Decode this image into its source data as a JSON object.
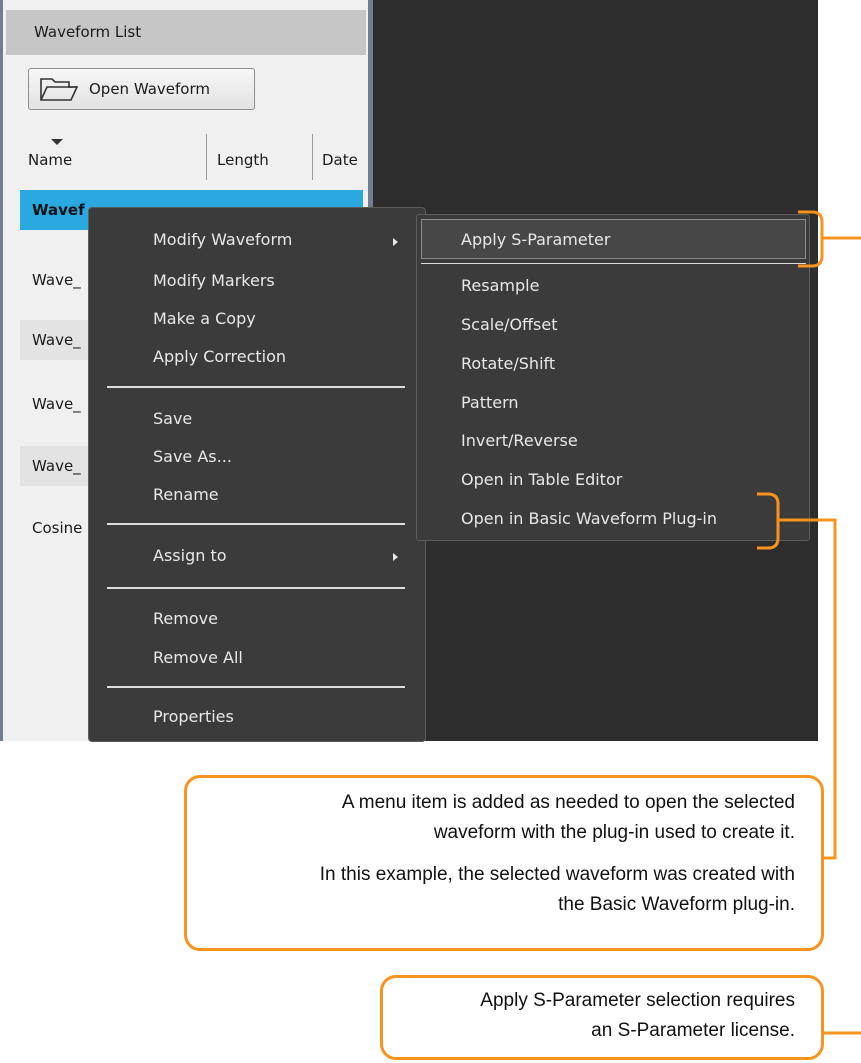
{
  "panel": {
    "header": "Waveform List",
    "open_button": "Open Waveform",
    "columns": [
      "Name",
      "Length",
      "Date"
    ],
    "rows": [
      "Wavef",
      "Wave_",
      "Wave_",
      "Wave_",
      "Wave_",
      "Cosine"
    ]
  },
  "context_menu": {
    "items": [
      "Modify Waveform",
      "Modify Markers",
      "Make a Copy",
      "Apply Correction",
      "Save",
      "Save As...",
      "Rename",
      "Assign to",
      "Remove",
      "Remove All",
      "Properties"
    ]
  },
  "submenu": {
    "items": [
      "Apply S-Parameter",
      "Resample",
      "Scale/Offset",
      "Rotate/Shift",
      "Pattern",
      "Invert/Reverse",
      "Open in Table Editor",
      "Open in Basic Waveform Plug-in"
    ]
  },
  "callouts": {
    "plugin_line1": "A menu item is added as needed to open the selected",
    "plugin_line2": "waveform with the plug-in used to create it.",
    "plugin_line3": "In this example, the selected waveform was created with",
    "plugin_line4": "the Basic Waveform plug-in.",
    "sparam_line1": "Apply S-Parameter selection requires",
    "sparam_line2": "an S-Parameter license."
  },
  "colors": {
    "accent_selected": "#2aa8e0",
    "callout_orange": "#f7931e",
    "menu_bg": "#3b3b3b"
  },
  "icons": [
    "folder-icon",
    "sort-down-icon",
    "submenu-arrow-icon"
  ]
}
